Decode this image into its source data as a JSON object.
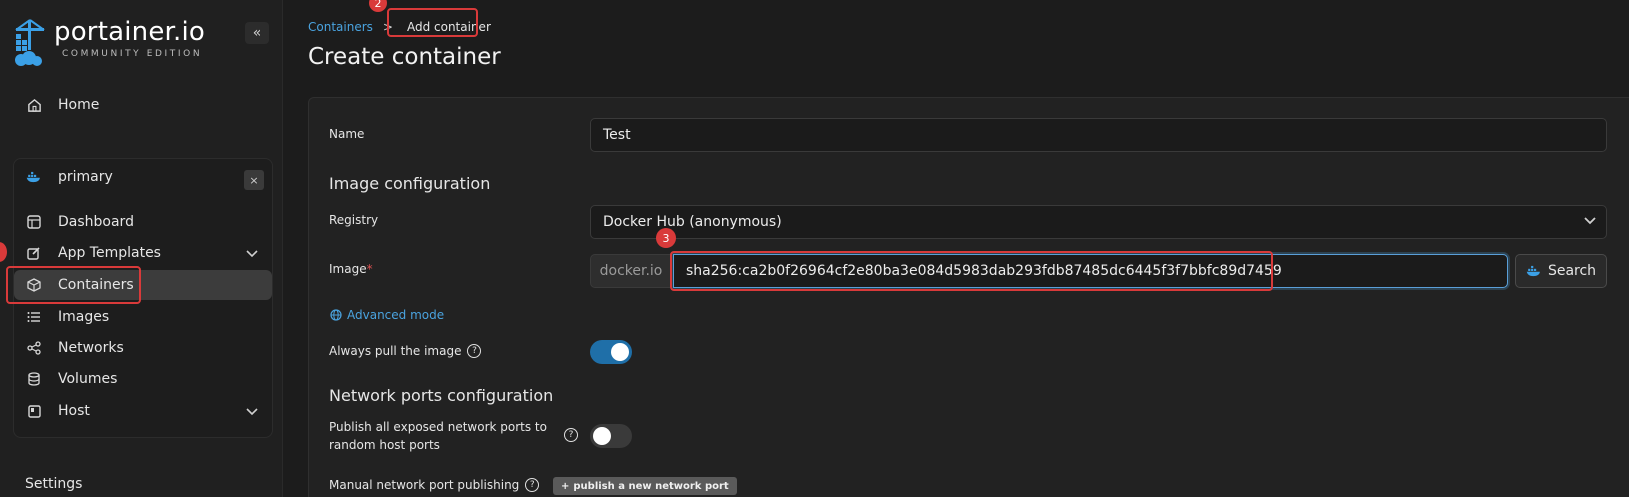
{
  "brand": {
    "title": "portainer.io",
    "subtitle": "COMMUNITY EDITION"
  },
  "sidebar": {
    "collapse_icon": "«",
    "home": "Home",
    "environment": {
      "name": "primary",
      "close_icon": "×"
    },
    "items": [
      {
        "label": "Dashboard",
        "icon": "dashboard-icon"
      },
      {
        "label": "App Templates",
        "icon": "edit-icon",
        "expandable": true
      },
      {
        "label": "Containers",
        "icon": "cube-icon",
        "active": true
      },
      {
        "label": "Images",
        "icon": "list-icon"
      },
      {
        "label": "Networks",
        "icon": "share-icon"
      },
      {
        "label": "Volumes",
        "icon": "database-icon"
      },
      {
        "label": "Host",
        "icon": "host-icon",
        "expandable": true
      }
    ],
    "settings": "Settings"
  },
  "breadcrumb": {
    "root": "Containers",
    "separator": ">",
    "current": "Add container"
  },
  "annotations": {
    "marker2": "2",
    "marker3": "3"
  },
  "page_title": "Create container",
  "form": {
    "name_label": "Name",
    "name_value": "Test",
    "image_config_title": "Image configuration",
    "registry_label": "Registry",
    "registry_value": "Docker Hub (anonymous)",
    "image_label": "Image",
    "image_required": "*",
    "image_prefix": "docker.io",
    "image_value": "sha256:ca2b0f26964cf2e80ba3e084d5983dab293fdb87485dc6445f3f7bbfc89d7459",
    "search_label": "Search",
    "advanced_mode": "Advanced mode",
    "always_pull_label": "Always pull the image",
    "always_pull_on": true,
    "network_title": "Network ports configuration",
    "publish_all_label_1": "Publish all exposed network ports to",
    "publish_all_label_2": "random host ports",
    "publish_all_on": false,
    "manual_publish_label": "Manual network port publishing",
    "publish_new_port": "publish a new network port"
  },
  "colors": {
    "accent": "#4aa3df",
    "annotation": "#d93a3a",
    "toggle_on": "#1f6fa8"
  }
}
